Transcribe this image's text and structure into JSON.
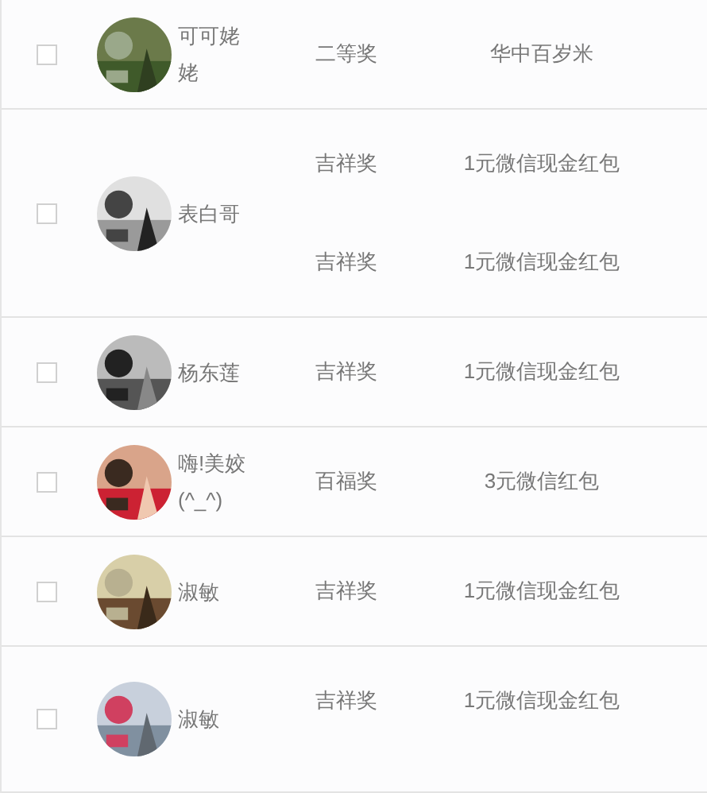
{
  "rows": [
    {
      "checked": false,
      "name": "可可姥姥",
      "avatar": {
        "kind": "picture"
      },
      "prizes": [
        {
          "level": "二等奖",
          "reward": "华中百岁米"
        }
      ]
    },
    {
      "checked": false,
      "name": "表白哥",
      "avatar": {
        "kind": "picture"
      },
      "prizes": [
        {
          "level": "吉祥奖",
          "reward": "1元微信现金红包"
        },
        {
          "level": "吉祥奖",
          "reward": "1元微信现金红包"
        }
      ]
    },
    {
      "checked": false,
      "name": "杨东莲",
      "avatar": {
        "kind": "picture"
      },
      "prizes": [
        {
          "level": "吉祥奖",
          "reward": "1元微信现金红包"
        }
      ]
    },
    {
      "checked": false,
      "name": "嗨!美姣(^_^)",
      "avatar": {
        "kind": "picture"
      },
      "prizes": [
        {
          "level": "百福奖",
          "reward": "3元微信红包"
        }
      ]
    },
    {
      "checked": false,
      "name": "淑敏",
      "avatar": {
        "kind": "picture"
      },
      "prizes": [
        {
          "level": "吉祥奖",
          "reward": "1元微信现金红包"
        }
      ]
    },
    {
      "checked": false,
      "name": "淑敏",
      "avatar": {
        "kind": "picture"
      },
      "prizes": [
        {
          "level": "吉祥奖",
          "reward": "1元微信现金红包"
        }
      ]
    }
  ]
}
